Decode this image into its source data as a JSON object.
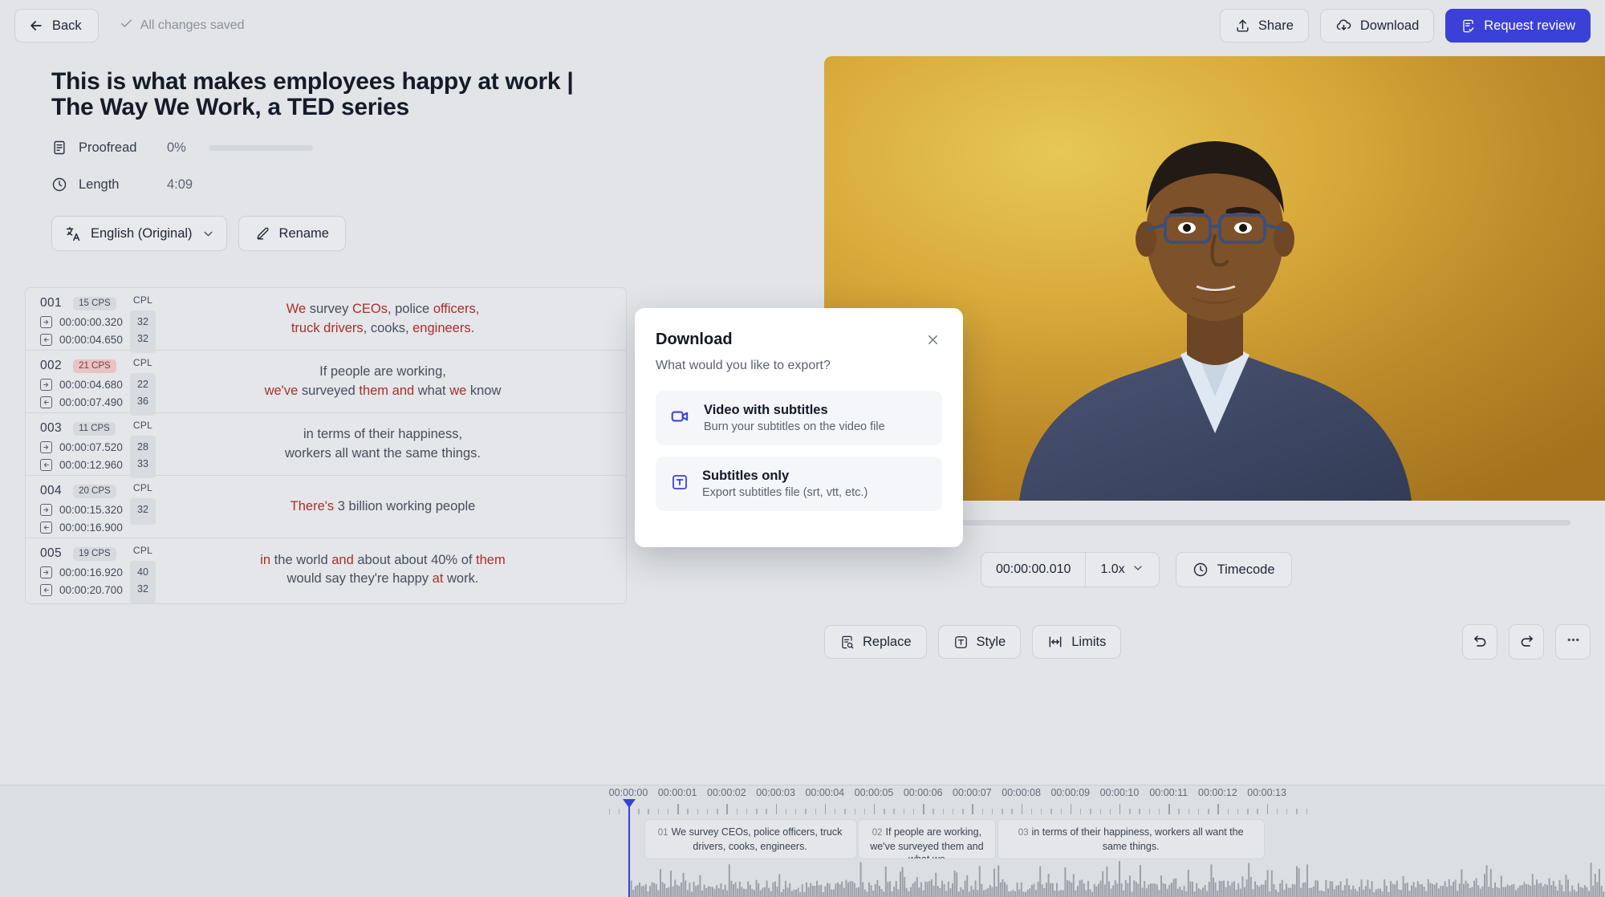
{
  "topbar": {
    "back_label": "Back",
    "saved_status": "All changes saved",
    "share_label": "Share",
    "download_label": "Download",
    "request_review_label": "Request review"
  },
  "project": {
    "title": "This is what makes employees happy at work | The Way We Work, a TED series",
    "proofread_label": "Proofread",
    "proofread_value": "0%",
    "proofread_percent": 0,
    "length_label": "Length",
    "length_value": "4:09",
    "language_label": "English (Original)",
    "rename_label": "Rename"
  },
  "subtitles": {
    "cpl_header": "CPL",
    "rows": [
      {
        "index": "001",
        "cps": "15 CPS",
        "cps_warn": false,
        "start": "00:00:00.320",
        "end": "00:00:04.650",
        "cpl": [
          "32",
          "32"
        ],
        "lines": [
          [
            {
              "t": "We",
              "hl": true
            },
            {
              "t": " survey ",
              "hl": false
            },
            {
              "t": "CEOs",
              "hl": true
            },
            {
              "t": ", police ",
              "hl": false
            },
            {
              "t": "officers,",
              "hl": true
            }
          ],
          [
            {
              "t": "truck drivers",
              "hl": true
            },
            {
              "t": ", cooks, ",
              "hl": false
            },
            {
              "t": "engineers.",
              "hl": true
            }
          ]
        ]
      },
      {
        "index": "002",
        "cps": "21 CPS",
        "cps_warn": true,
        "start": "00:00:04.680",
        "end": "00:00:07.490",
        "cpl": [
          "22",
          "36"
        ],
        "lines": [
          [
            {
              "t": "If people are working,",
              "hl": false
            }
          ],
          [
            {
              "t": "we've",
              "hl": true
            },
            {
              "t": " surveyed ",
              "hl": false
            },
            {
              "t": "them and",
              "hl": true
            },
            {
              "t": " what ",
              "hl": false
            },
            {
              "t": "we",
              "hl": true
            },
            {
              "t": " know",
              "hl": false
            }
          ]
        ]
      },
      {
        "index": "003",
        "cps": "11 CPS",
        "cps_warn": false,
        "start": "00:00:07.520",
        "end": "00:00:12.960",
        "cpl": [
          "28",
          "33"
        ],
        "lines": [
          [
            {
              "t": "in terms of their happiness,",
              "hl": false
            }
          ],
          [
            {
              "t": "workers all want the same things.",
              "hl": false
            }
          ]
        ]
      },
      {
        "index": "004",
        "cps": "20 CPS",
        "cps_warn": false,
        "start": "00:00:15.320",
        "end": "00:00:16.900",
        "cpl": [
          "32"
        ],
        "lines": [
          [
            {
              "t": "There's",
              "hl": true
            },
            {
              "t": " 3 billion working people",
              "hl": false
            }
          ]
        ]
      },
      {
        "index": "005",
        "cps": "19 CPS",
        "cps_warn": false,
        "start": "00:00:16.920",
        "end": "00:00:20.700",
        "cpl": [
          "40",
          "32"
        ],
        "lines": [
          [
            {
              "t": "in",
              "hl": true
            },
            {
              "t": " the world ",
              "hl": false
            },
            {
              "t": "and",
              "hl": true
            },
            {
              "t": " about about 40% of ",
              "hl": false
            },
            {
              "t": "them",
              "hl": true
            }
          ],
          [
            {
              "t": "would say they're happy ",
              "hl": false
            },
            {
              "t": "at",
              "hl": true
            },
            {
              "t": " work.",
              "hl": false
            }
          ]
        ]
      }
    ]
  },
  "player": {
    "current_time": "00:00:00.010",
    "speed": "1.0x",
    "timecode_label": "Timecode"
  },
  "toolbar": {
    "replace_label": "Replace",
    "style_label": "Style",
    "limits_label": "Limits"
  },
  "modal": {
    "title": "Download",
    "subtitle": "What would you like to export?",
    "options": [
      {
        "icon": "video-camera-icon",
        "title": "Video with subtitles",
        "desc": "Burn your subtitles on the video file"
      },
      {
        "icon": "text-box-icon",
        "title": "Subtitles only",
        "desc": "Export subtitles file (srt, vtt, etc.)"
      }
    ]
  },
  "timeline": {
    "ticks": [
      "00:00:00",
      "00:00:01",
      "00:00:02",
      "00:00:03",
      "00:00:04",
      "00:00:05",
      "00:00:06",
      "00:00:07",
      "00:00:08",
      "00:00:09",
      "00:00:10",
      "00:00:11",
      "00:00:12",
      "00:00:13"
    ],
    "playhead_time": "00:00:00.010",
    "blocks": [
      {
        "num": "01",
        "text": "We survey CEOs, police officers, truck drivers, cooks, engineers.",
        "start": 0.32,
        "end": 4.65
      },
      {
        "num": "02",
        "text": "If people are working, we've surveyed them and what we",
        "start": 4.68,
        "end": 7.49
      },
      {
        "num": "03",
        "text": "in terms of their happiness, workers all want the same things.",
        "start": 7.52,
        "end": 12.96
      }
    ]
  },
  "colors": {
    "accent": "#3b41d6",
    "warn_badge_bg": "#e8c3c3",
    "highlight_text": "#a5302c",
    "page_bg": "#e2e4e7"
  }
}
